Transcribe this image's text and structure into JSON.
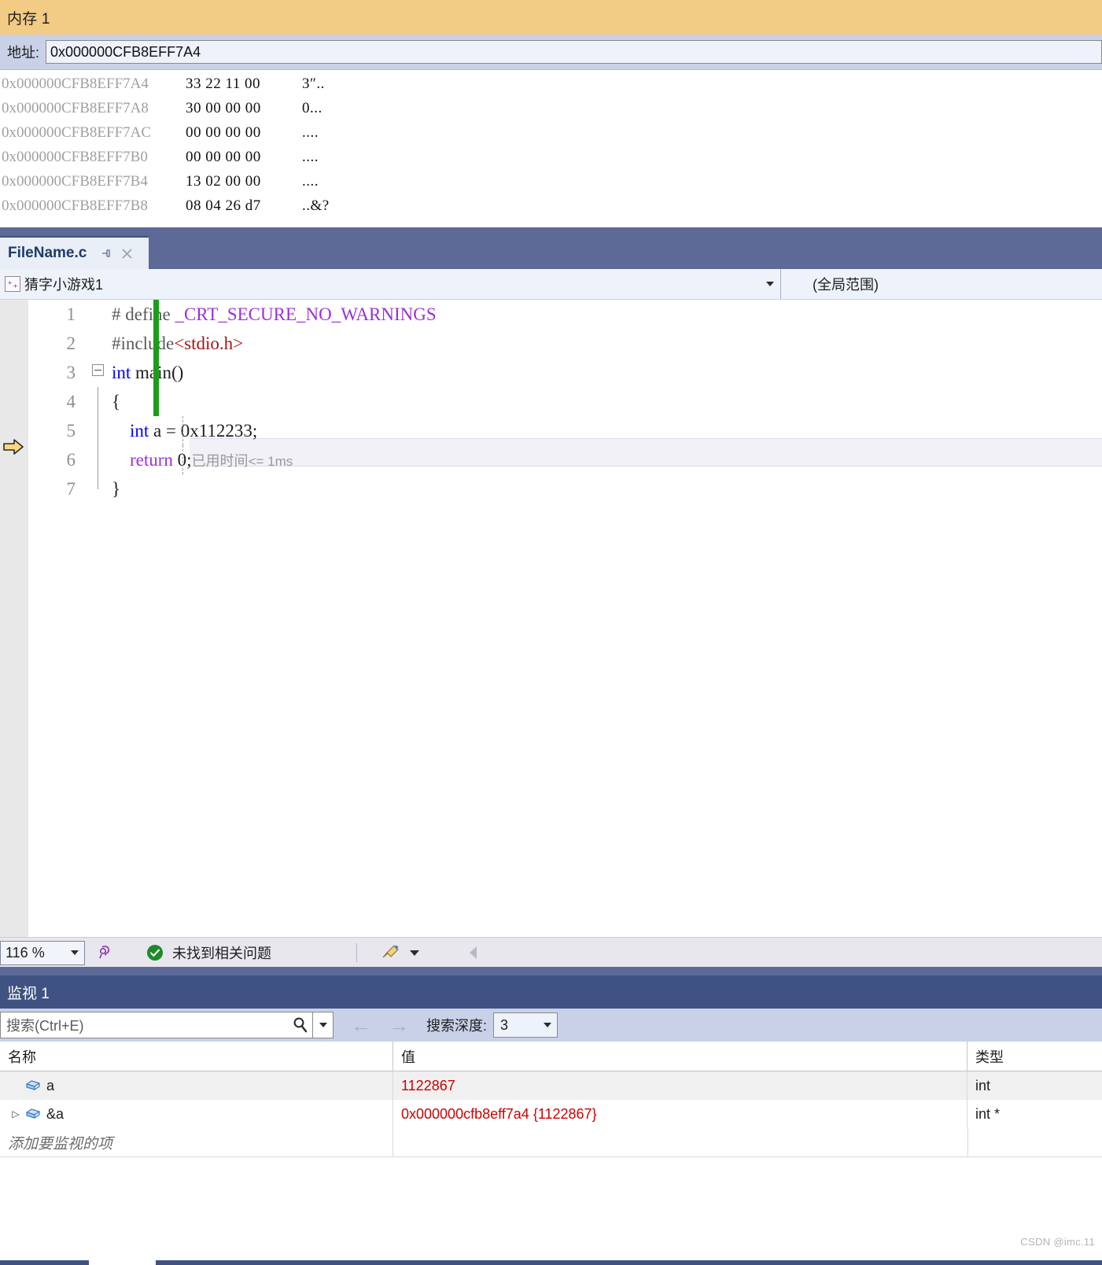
{
  "memory_window": {
    "title": "内存 1",
    "address_label": "地址:",
    "address_value": "0x000000CFB8EFF7A4",
    "rows": [
      {
        "address": "0x000000CFB8EFF7A4",
        "hex": "33 22 11 00",
        "ascii": "3″.."
      },
      {
        "address": "0x000000CFB8EFF7A8",
        "hex": "30 00 00 00",
        "ascii": "0..."
      },
      {
        "address": "0x000000CFB8EFF7AC",
        "hex": "00 00 00 00",
        "ascii": "...."
      },
      {
        "address": "0x000000CFB8EFF7B0",
        "hex": "00 00 00 00",
        "ascii": "...."
      },
      {
        "address": "0x000000CFB8EFF7B4",
        "hex": "13 02 00 00",
        "ascii": "...."
      },
      {
        "address": "0x000000CFB8EFF7B8",
        "hex": "08 04 26 d7",
        "ascii": "..&?"
      }
    ]
  },
  "editor": {
    "tab_label": "FileName.c",
    "pin_icon": "pin-icon",
    "close_icon": "close-icon",
    "project_scope": "猜字小游戏1",
    "member_scope": "(全局范围)",
    "lines": [
      {
        "num": "1",
        "tokens": [
          {
            "t": "# define ",
            "c": "pp"
          },
          {
            "t": "_CRT_SECURE_NO_WARNINGS",
            "c": "macro"
          }
        ]
      },
      {
        "num": "2",
        "tokens": [
          {
            "t": "#include",
            "c": "pp"
          },
          {
            "t": "<stdio.h>",
            "c": "str"
          }
        ]
      },
      {
        "num": "3",
        "tokens": [
          {
            "t": "int",
            "c": "kw"
          },
          {
            "t": " main()",
            "c": "plain"
          }
        ]
      },
      {
        "num": "4",
        "tokens": [
          {
            "t": "{",
            "c": "plain"
          }
        ]
      },
      {
        "num": "5",
        "tokens": [
          {
            "t": "    int",
            "c": "kw"
          },
          {
            "t": " a = 0x112233;",
            "c": "plain"
          }
        ]
      },
      {
        "num": "6",
        "tokens": [
          {
            "t": "    return",
            "c": "macro"
          },
          {
            "t": " 0;",
            "c": "plain"
          }
        ]
      },
      {
        "num": "7",
        "tokens": [
          {
            "t": "}",
            "c": "plain"
          }
        ]
      }
    ],
    "elapsed_label": "已用时间",
    "elapsed_value": "<= 1ms",
    "current_line": "6"
  },
  "status_bar": {
    "zoom_level": "116 %",
    "intellisense_icon": "intellisense-icon",
    "ok_icon": "check-circle-icon",
    "message": "未找到相关问题",
    "broom_icon": "broom-icon"
  },
  "watch_window": {
    "title": "监视 1",
    "search_placeholder": "搜索(Ctrl+E)",
    "search_icon": "search-icon",
    "back_arrow": "←",
    "forward_arrow": "→",
    "depth_label": "搜索深度:",
    "depth_value": "3",
    "columns": [
      "名称",
      "值",
      "类型"
    ],
    "rows": [
      {
        "expander": "",
        "icon": "variable-icon",
        "name": "a",
        "value": "1122867",
        "type": "int"
      },
      {
        "expander": "▷",
        "icon": "variable-icon",
        "name": "&a",
        "value": "0x000000cfb8eff7a4 {1122867}",
        "type": "int *"
      }
    ],
    "add_placeholder": "添加要监视的项"
  },
  "watermark": "CSDN @imc.11",
  "colors": {
    "memory_title_bg": "#f2cb85",
    "toolbar_bg": "#c9d1e8",
    "tabstrip_bg": "#5d6a97",
    "watch_title_bg": "#3f5282",
    "value_red": "#d00000",
    "keyword_blue": "#0000ff",
    "macro_purple": "#9b30d9",
    "string_red": "#a31515",
    "changebar_green": "#1a9e1a",
    "exec_arrow": "#fcd77f"
  }
}
